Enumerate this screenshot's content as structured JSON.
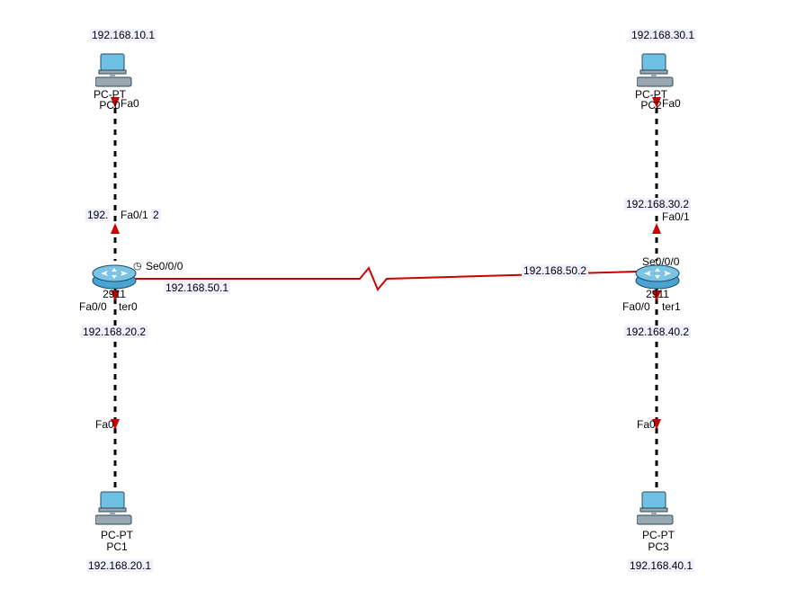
{
  "colors": {
    "link_red": "#cc0000",
    "link_black": "#000000",
    "pc_screen": "#6ec1e4",
    "pc_body": "#9aa7b0",
    "router_body": "#4aa3d1",
    "router_top": "#7cc3e4"
  },
  "devices": {
    "pc0": {
      "ip": "192.168.10.1",
      "type_line": "PC-PT",
      "name_line": "PC0",
      "iface": "Fa0"
    },
    "pc1": {
      "ip": "192.168.20.1",
      "type_line": "PC-PT",
      "name_line": "PC1",
      "iface": "Fa0"
    },
    "pc2": {
      "ip": "192.168.30.1",
      "type_line": "PC-PT",
      "name_line": "PC2",
      "iface": "Fa0"
    },
    "pc3": {
      "ip": "192.168.40.1",
      "type_line": "PC-PT",
      "name_line": "PC3",
      "iface": "Fa0"
    },
    "router0": {
      "model": "2911",
      "name": "Router0",
      "fa00": "Fa0/0",
      "fa01": "Fa0/1",
      "se000": "Se0/0/0"
    },
    "router1": {
      "model": "2911",
      "name": "Router1",
      "fa00": "Fa0/0",
      "fa01": "Fa0/1",
      "se000": "Se0/0/0"
    }
  },
  "interfaces": {
    "r0_fa01_ip_prefix": "192.",
    "r0_fa01_ip_suffix": "2",
    "r0_fa00_ip": "192.168.20.2",
    "r0_se_ip": "192.168.50.1",
    "r1_fa01_ip": "192.168.30.2",
    "r1_fa00_ip": "192.168.40.2",
    "r1_se_ip": "192.168.50.2"
  },
  "clock_symbol": "◷"
}
